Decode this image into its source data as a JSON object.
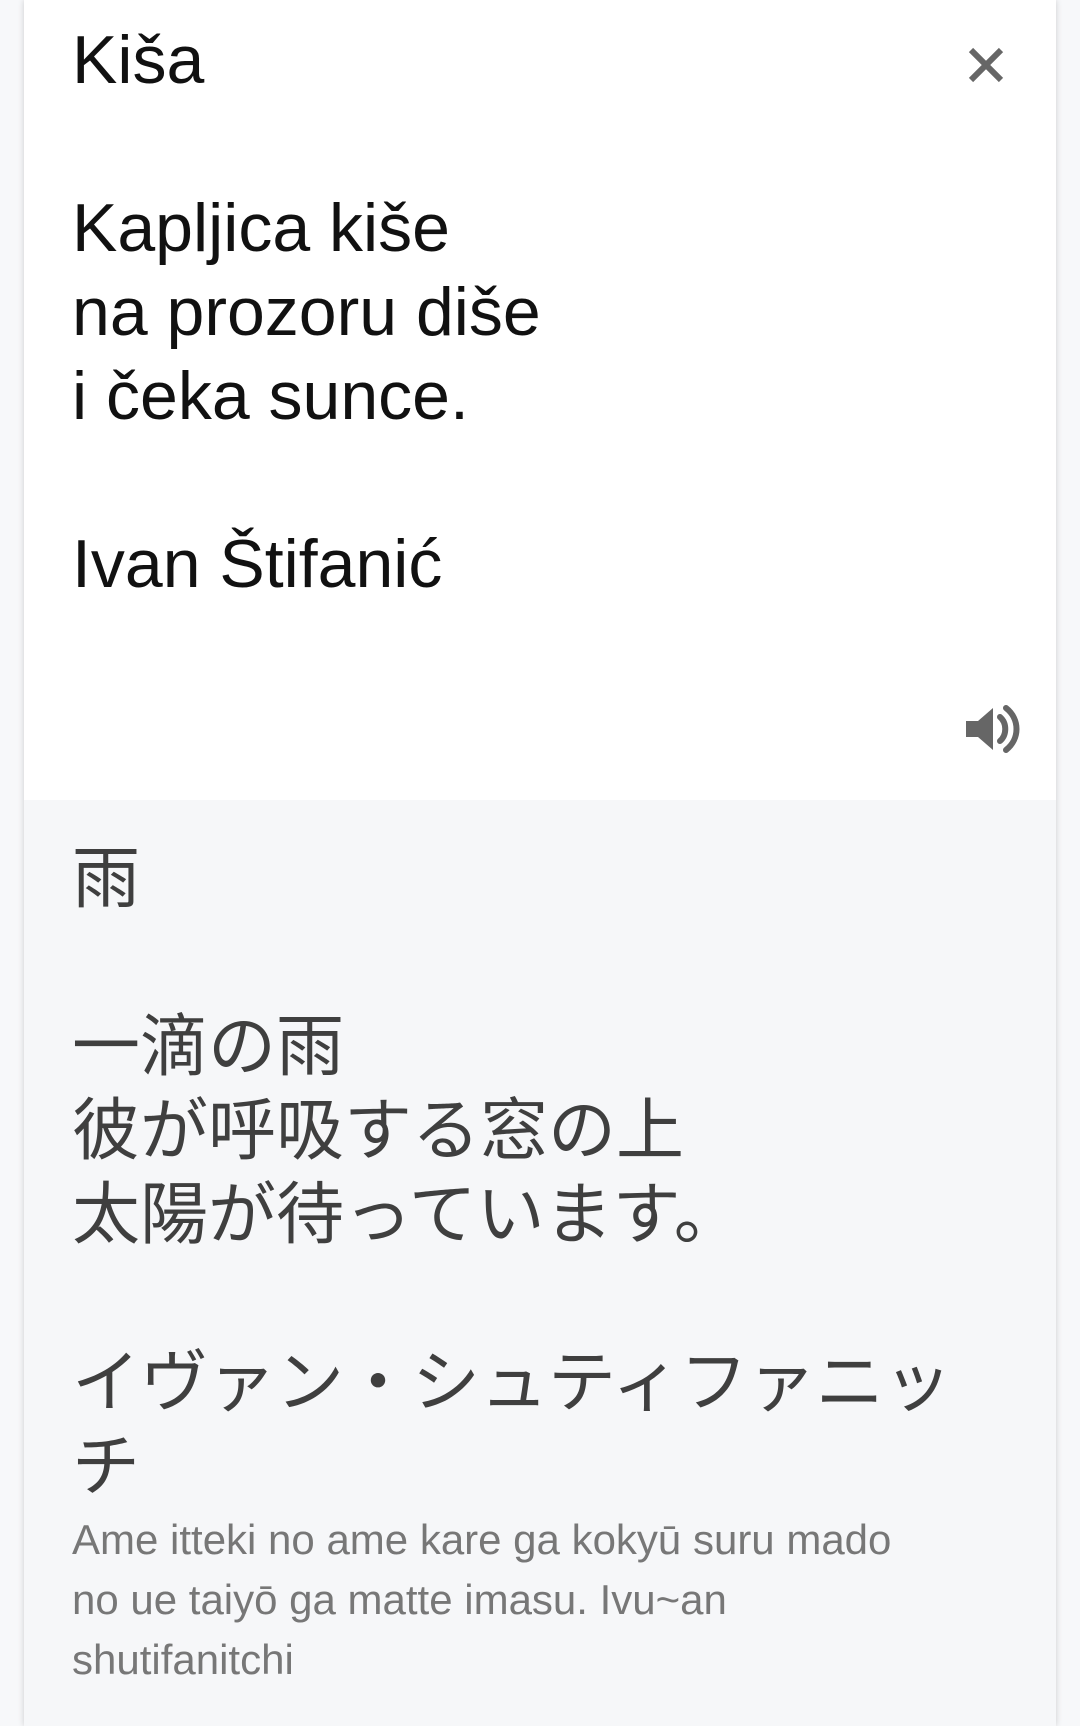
{
  "source": {
    "text": "Kiša\n\nKapljica kiše\nna prozoru diše\ni čeka sunce.\n\nIvan Štifanić"
  },
  "translation": {
    "text": "雨\n\n一滴の雨\n彼が呼吸する窓の上\n太陽が待っています。\n\nイヴァン・シュティファニッ\nチ",
    "romanization": "Ame itteki no ame kare ga kokyū suru mado\nno ue taiyō ga matte imasu. Ivu~an\nshutifanitchi"
  },
  "icons": {
    "close": "close-icon",
    "speaker": "speaker-icon"
  },
  "colors": {
    "source_bg": "#ffffff",
    "translation_bg": "#f6f7f9",
    "source_text": "#111111",
    "translation_text": "#3f3f3f",
    "romanization_text": "#777777",
    "icon": "#666666"
  }
}
